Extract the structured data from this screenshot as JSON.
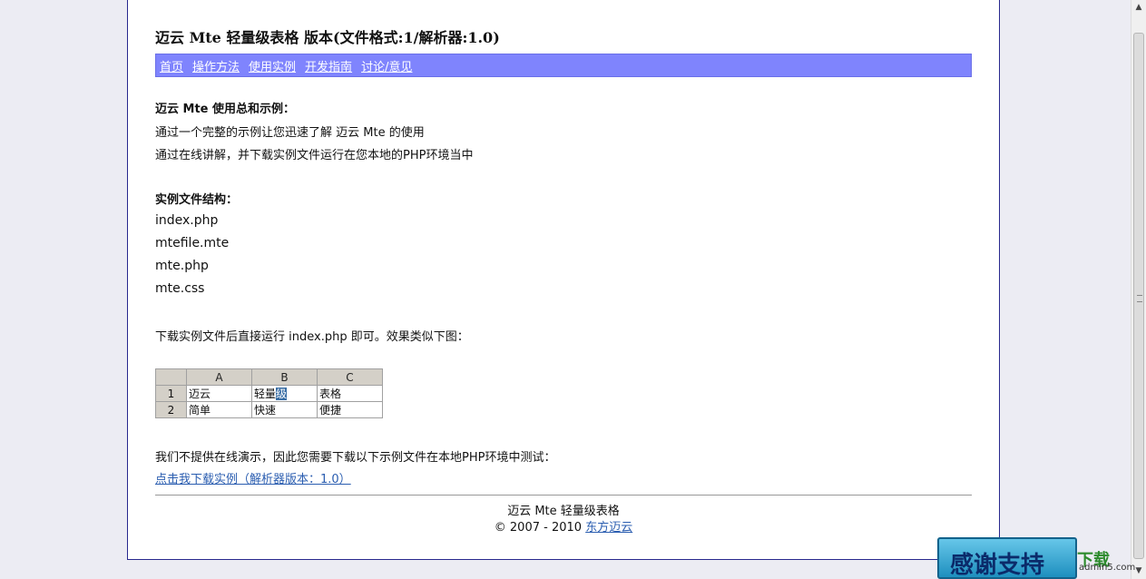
{
  "page_title": "迈云 Mte 轻量级表格 版本(文件格式:1/解析器:1.0)",
  "nav": [
    {
      "label": "首页",
      "name": "nav-home"
    },
    {
      "label": "操作方法",
      "name": "nav-operation"
    },
    {
      "label": "使用实例",
      "name": "nav-examples"
    },
    {
      "label": "开发指南",
      "name": "nav-dev-guide"
    },
    {
      "label": "讨论/意见",
      "name": "nav-discussion"
    }
  ],
  "intro": {
    "heading": "迈云 Mte 使用总和示例：",
    "line1": "通过一个完整的示例让您迅速了解 迈云 Mte 的使用",
    "line2": "通过在线讲解，并下载实例文件运行在您本地的PHP环境当中"
  },
  "structure": {
    "heading": "实例文件结构：",
    "files": [
      "index.php",
      "mtefile.mte",
      "mte.php",
      "mte.css"
    ]
  },
  "run_note": "下载实例文件后直接运行 index.php 即可。效果类似下图：",
  "grid": {
    "columns": [
      "A",
      "B",
      "C"
    ],
    "rows": [
      {
        "num": "1",
        "cells": [
          "迈云",
          "轻量级",
          "表格"
        ]
      },
      {
        "num": "2",
        "cells": [
          "简单",
          "快速",
          "便捷"
        ]
      }
    ]
  },
  "no_demo": "我们不提供在线演示，因此您需要下载以下示例文件在本地PHP环境中测试：",
  "download_link": "点击我下载实例（解析器版本：1.0）",
  "footer": {
    "line1": "迈云 Mte 轻量级表格",
    "copyright": "© 2007 - 2010",
    "link": "东方迈云"
  },
  "promo_text": "感谢支持",
  "watermark": {
    "top": "下载",
    "bottom": "admin5.com"
  }
}
